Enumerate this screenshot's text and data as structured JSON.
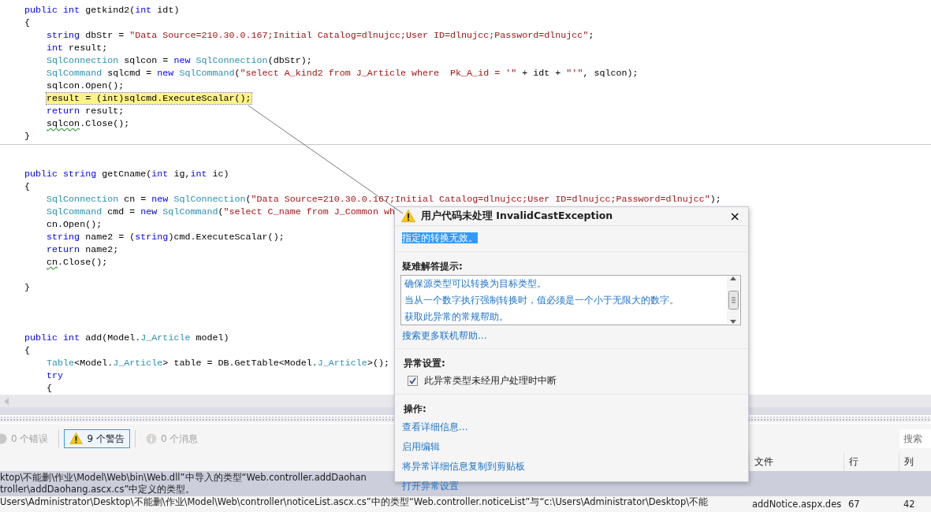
{
  "editor": {
    "lines": [
      {
        "kind": "code",
        "tokens": [
          {
            "kind": "keyword",
            "text": "public"
          },
          {
            "kind": "keyword",
            "text": " int"
          },
          {
            "kind": "plain",
            "text": " getkind2("
          },
          {
            "kind": "keyword",
            "text": "int"
          },
          {
            "kind": "plain",
            "text": " idt)"
          }
        ]
      },
      {
        "kind": "code",
        "tokens": [
          {
            "kind": "plain",
            "text": "{"
          }
        ]
      },
      {
        "kind": "code",
        "indented": true,
        "tokens": [
          {
            "kind": "keyword",
            "text": "string"
          },
          {
            "kind": "plain",
            "text": " dbStr = "
          },
          {
            "kind": "string",
            "text": "\"Data Source=210.30.0.167;Initial Catalog=dlnujcc;User ID=dlnujcc;Password=dlnujcc\""
          },
          {
            "kind": "plain",
            "text": ";"
          }
        ]
      },
      {
        "kind": "code",
        "indented": true,
        "tokens": [
          {
            "kind": "keyword",
            "text": "int"
          },
          {
            "kind": "plain",
            "text": " result;"
          }
        ]
      },
      {
        "kind": "code",
        "indented": true,
        "tokens": [
          {
            "kind": "type",
            "text": "SqlConnection"
          },
          {
            "kind": "plain",
            "text": " sqlcon = "
          },
          {
            "kind": "keyword",
            "text": "new"
          },
          {
            "kind": "type",
            "text": " SqlConnection"
          },
          {
            "kind": "plain",
            "text": "(dbStr);"
          }
        ]
      },
      {
        "kind": "code",
        "indented": true,
        "tokens": [
          {
            "kind": "type",
            "text": "SqlCommand"
          },
          {
            "kind": "plain",
            "text": " sqlcmd = "
          },
          {
            "kind": "keyword",
            "text": "new"
          },
          {
            "kind": "type",
            "text": " SqlCommand"
          },
          {
            "kind": "plain",
            "text": "("
          },
          {
            "kind": "string",
            "text": "\"select A_kind2 from J_Article where  Pk_A_id = '\""
          },
          {
            "kind": "plain",
            "text": " + idt + "
          },
          {
            "kind": "string",
            "text": "\"'\""
          },
          {
            "kind": "plain",
            "text": ", sqlcon);"
          }
        ]
      },
      {
        "kind": "code",
        "indented": true,
        "tokens": [
          {
            "kind": "plain",
            "text": "sqlcon.Open();"
          }
        ]
      },
      {
        "kind": "code",
        "indented": true,
        "highlighted": true,
        "tokens": [
          {
            "kind": "plain",
            "text": "result = (int)sqlcmd.ExecuteScalar();"
          }
        ]
      },
      {
        "kind": "code",
        "indented": true,
        "tokens": [
          {
            "kind": "keyword",
            "text": "return"
          },
          {
            "kind": "plain",
            "text": " result;"
          }
        ]
      },
      {
        "kind": "code",
        "indented": true,
        "tokens": [
          {
            "kind": "plain",
            "text": "sqlcon",
            "warning": true
          },
          {
            "kind": "plain",
            "text": ".Close();"
          }
        ]
      },
      {
        "kind": "code",
        "tokens": [
          {
            "kind": "plain",
            "text": "}"
          }
        ]
      },
      {
        "kind": "separator"
      },
      {
        "kind": "blank"
      },
      {
        "kind": "code",
        "tokens": [
          {
            "kind": "keyword",
            "text": "public"
          },
          {
            "kind": "keyword",
            "text": " string"
          },
          {
            "kind": "plain",
            "text": " getCname("
          },
          {
            "kind": "keyword",
            "text": "int"
          },
          {
            "kind": "plain",
            "text": " ig,"
          },
          {
            "kind": "keyword",
            "text": "int"
          },
          {
            "kind": "plain",
            "text": " ic)"
          }
        ]
      },
      {
        "kind": "code",
        "tokens": [
          {
            "kind": "plain",
            "text": "{"
          }
        ]
      },
      {
        "kind": "code",
        "indented": true,
        "tokens": [
          {
            "kind": "type",
            "text": "SqlConnection"
          },
          {
            "kind": "plain",
            "text": " cn = "
          },
          {
            "kind": "keyword",
            "text": "new"
          },
          {
            "kind": "type",
            "text": " SqlConnection"
          },
          {
            "kind": "plain",
            "text": "("
          },
          {
            "kind": "string",
            "text": "\"Data Source=210.30.0.167;Initial Catalog=dlnujcc;User ID=dlnujcc;Password=dlnujcc\""
          },
          {
            "kind": "plain",
            "text": ");"
          }
        ]
      },
      {
        "kind": "code",
        "indented": true,
        "tokens": [
          {
            "kind": "type",
            "text": "SqlCommand"
          },
          {
            "kind": "plain",
            "text": " cmd = "
          },
          {
            "kind": "keyword",
            "text": "new"
          },
          {
            "kind": "type",
            "text": " SqlCommand"
          },
          {
            "kind": "plain",
            "text": "("
          },
          {
            "kind": "string",
            "text": "\"select C_name from J_Common wh"
          }
        ]
      },
      {
        "kind": "code",
        "indented": true,
        "tokens": [
          {
            "kind": "plain",
            "text": "cn.Open();"
          }
        ]
      },
      {
        "kind": "code",
        "indented": true,
        "tokens": [
          {
            "kind": "keyword",
            "text": "string"
          },
          {
            "kind": "plain",
            "text": " name2 = ("
          },
          {
            "kind": "keyword",
            "text": "string"
          },
          {
            "kind": "plain",
            "text": ")cmd.ExecuteScalar();"
          }
        ]
      },
      {
        "kind": "code",
        "indented": true,
        "tokens": [
          {
            "kind": "keyword",
            "text": "return"
          },
          {
            "kind": "plain",
            "text": " name2;"
          }
        ]
      },
      {
        "kind": "code",
        "indented": true,
        "tokens": [
          {
            "kind": "plain",
            "text": "cn",
            "warning": true
          },
          {
            "kind": "plain",
            "text": ".Close();"
          }
        ]
      },
      {
        "kind": "blank"
      },
      {
        "kind": "code",
        "tokens": [
          {
            "kind": "plain",
            "text": "}"
          }
        ]
      },
      {
        "kind": "blank"
      },
      {
        "kind": "blank"
      },
      {
        "kind": "blank"
      },
      {
        "kind": "code",
        "tokens": [
          {
            "kind": "keyword",
            "text": "public"
          },
          {
            "kind": "keyword",
            "text": " int"
          },
          {
            "kind": "plain",
            "text": " add(Model."
          },
          {
            "kind": "type",
            "text": "J_Article"
          },
          {
            "kind": "plain",
            "text": " model)"
          }
        ]
      },
      {
        "kind": "code",
        "tokens": [
          {
            "kind": "plain",
            "text": "{"
          }
        ]
      },
      {
        "kind": "code",
        "indented": true,
        "tokens": [
          {
            "kind": "type",
            "text": "Table"
          },
          {
            "kind": "plain",
            "text": "<Model."
          },
          {
            "kind": "type",
            "text": "J_Article"
          },
          {
            "kind": "plain",
            "text": "> table = DB.GetTable<Model."
          },
          {
            "kind": "type",
            "text": "J_Article"
          },
          {
            "kind": "plain",
            "text": ">();"
          }
        ]
      },
      {
        "kind": "code",
        "indented": true,
        "tokens": [
          {
            "kind": "keyword",
            "text": "try"
          }
        ]
      },
      {
        "kind": "code",
        "indented": true,
        "tokens": [
          {
            "kind": "plain",
            "text": "{"
          }
        ]
      }
    ]
  },
  "error_list": {
    "filters": [
      {
        "kind": "error",
        "label": "0 个错误",
        "selected": false,
        "disabled": true
      },
      {
        "kind": "warning",
        "label": "9 个警告",
        "selected": true,
        "disabled": false
      },
      {
        "kind": "message",
        "label": "0 个消息",
        "selected": false,
        "disabled": true
      }
    ],
    "search": {
      "placeholder": "搜索"
    },
    "columns": [
      "文件",
      "行",
      "列"
    ],
    "rows": [
      {
        "selected": true,
        "description": [
          "ktop\\不能删\\作业\\Model\\Web\\bin\\Web.dll”中导入的类型“Web.controller.addDaohan",
          "troller\\addDaohang.ascx.cs”中定义的类型。"
        ]
      },
      {
        "selected": false,
        "description": [
          "Users\\Administrator\\Desktop\\不能删\\作业\\Model\\Web\\controller\\noticeList.ascx.cs”中的类型“Web.controller.noticeList”与“c:\\Users\\Administrator\\Desktop\\不能"
        ],
        "file": "addNotice.aspx.des",
        "line": "67",
        "column": "42"
      }
    ]
  },
  "exception_popup": {
    "title": "用户代码未处理 InvalidCastException",
    "close": "×",
    "message": {
      "text": "指定的转换无效。",
      "selected": true
    },
    "tips_heading": "疑难解答提示:",
    "tips": [
      "确保源类型可以转换为目标类型。",
      "当从一个数字执行强制转换时，值必须是一个小于无限大的数字。",
      "获取此异常的常规帮助。"
    ],
    "search_link": "搜索更多联机帮助...",
    "settings_heading": "异常设置:",
    "break_option": {
      "label": "此异常类型未经用户处理时中断",
      "checked": true
    },
    "actions_heading": "操作:",
    "actions": [
      "查看详细信息...",
      "启用编辑",
      "将异常详细信息复制到剪贴板",
      "打开异常设置"
    ]
  }
}
